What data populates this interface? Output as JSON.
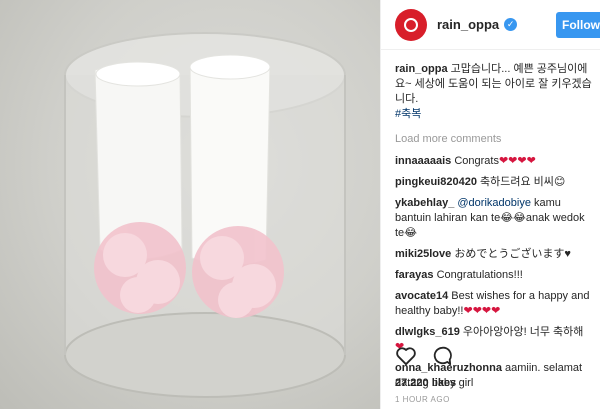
{
  "post": {
    "username": "rain_oppa",
    "verified_mark": "✓",
    "follow_label": "Follow",
    "avatar_color": "#d81e2a",
    "caption_user": "rain_oppa",
    "caption_text": " 고맙습니다... 예쁜 공주님이에요~ 세상에 도움이 되는 아이로 잘 키우겠습니다.",
    "hashtag": "#축복"
  },
  "load_more_label": "Load more comments",
  "comments": [
    {
      "user": "innaaaaais",
      "text": " Congrats",
      "suffix": "❤❤❤❤",
      "mention": ""
    },
    {
      "user": "pingkeui820420",
      "text": " 축하드려요 비씨",
      "suffix": "😊",
      "mention": ""
    },
    {
      "user": "ykabehlay_",
      "text": " kamu bantuin lahiran kan te😂😂anak wedok te😂",
      "suffix": "",
      "mention": "@dorikadobiye"
    },
    {
      "user": "miki25love",
      "text": " おめでとうございます",
      "suffix": "♥",
      "mention": ""
    },
    {
      "user": "farayas",
      "text": " Congratulations!!!",
      "suffix": "",
      "mention": ""
    },
    {
      "user": "avocate14",
      "text": " Best wishes for a happy and healthy baby!!",
      "suffix": "❤❤❤❤",
      "mention": ""
    },
    {
      "user": "dlwlgks_619",
      "text": " 우아아앙아앙! 너무 축하해",
      "suffix": "❤",
      "mention": ""
    },
    {
      "user": "onna_khaeruzhonna",
      "text": " aamiin. selamat datang baby girl",
      "suffix": "",
      "mention": ""
    }
  ],
  "likes_label": "27.220 likes",
  "time_label": "1 HOUR AGO",
  "icons": {
    "like": "heart-outline-icon",
    "comment": "comment-bubble-icon"
  },
  "colors": {
    "accent": "#3897f0",
    "mention": "#003569",
    "heart": "#d6163f"
  }
}
